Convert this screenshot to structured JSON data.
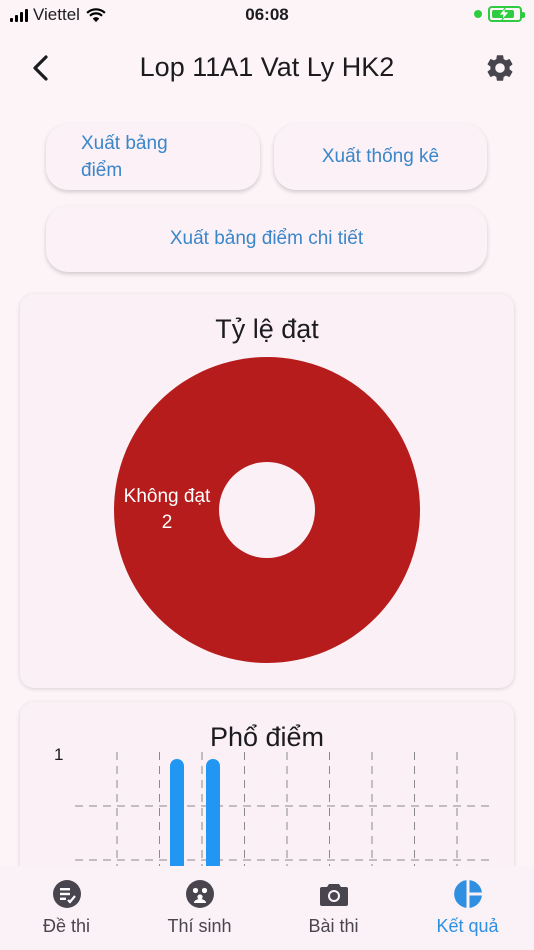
{
  "status_bar": {
    "carrier": "Viettel",
    "time": "06:08"
  },
  "appbar": {
    "title": "Lop 11A1 Vat Ly HK2"
  },
  "actions": {
    "export_gradebook": "Xuất bảng điểm",
    "export_stats": "Xuất thống kê",
    "export_gradebook_detail": "Xuất bảng điểm chi tiết"
  },
  "pass_rate": {
    "title": "Tỷ lệ đạt",
    "slice_label": "Không đạt",
    "slice_value": "2"
  },
  "score_spectrum": {
    "title": "Phổ điểm",
    "y_tick": "1"
  },
  "chart_data": [
    {
      "type": "pie",
      "title": "Tỷ lệ đạt",
      "categories": [
        "Không đạt"
      ],
      "values": [
        2
      ],
      "donut": true,
      "colors": [
        "#b71c1c"
      ]
    },
    {
      "type": "bar",
      "title": "Phổ điểm",
      "series": [
        {
          "values": [
            1,
            1
          ]
        }
      ],
      "ylim": [
        0,
        1
      ],
      "grid": true,
      "colors": [
        "#2196f3"
      ]
    }
  ],
  "nav": {
    "items": [
      {
        "label": "Đề thi",
        "icon": "exam-icon"
      },
      {
        "label": "Thí sinh",
        "icon": "students-icon"
      },
      {
        "label": "Bài thi",
        "icon": "camera-icon"
      },
      {
        "label": "Kết quả",
        "icon": "pie-chart-icon"
      }
    ],
    "active_color": "#2f8fe0",
    "inactive_color": "#49454f"
  }
}
